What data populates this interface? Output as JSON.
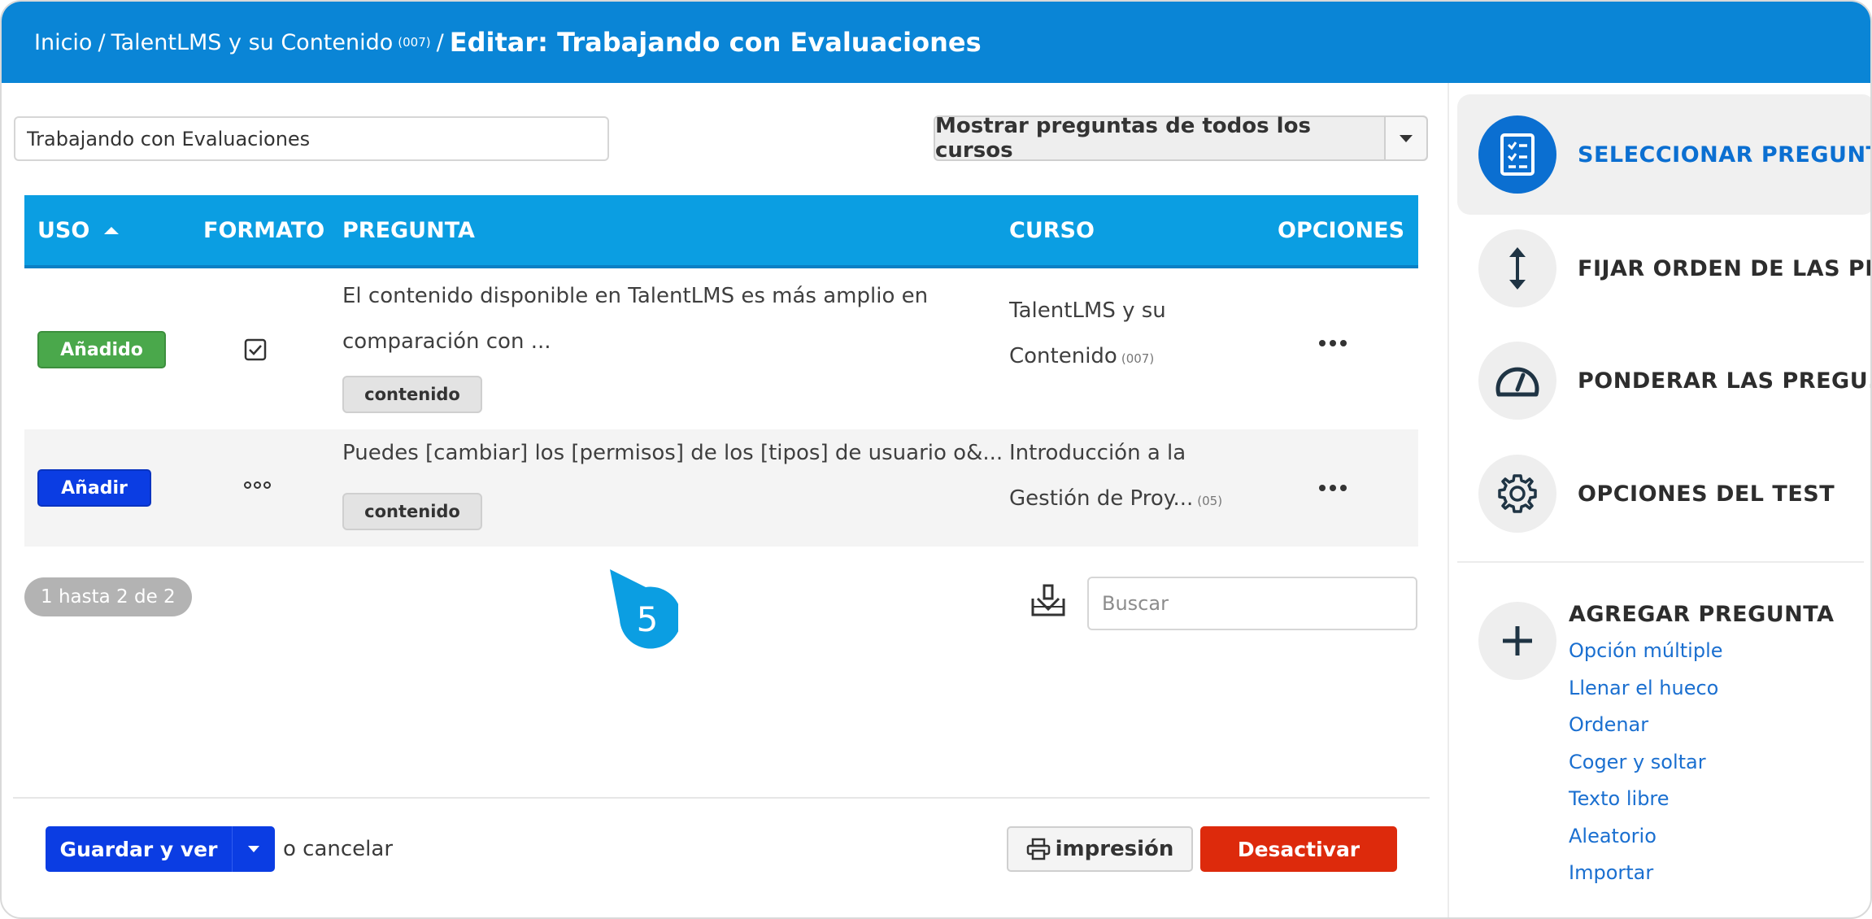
{
  "breadcrumb": {
    "home": "Inicio",
    "course": "TalentLMS y su Contenido",
    "course_code": "(007)",
    "current": "Editar: Trabajando con Evaluaciones"
  },
  "test_title": "Trabajando con Evaluaciones",
  "show_questions": {
    "label": "Mostrar preguntas de todos los cursos"
  },
  "table": {
    "columns": {
      "uso": "USO",
      "formato": "FORMATO",
      "pregunta": "PREGUNTA",
      "curso": "CURSO",
      "opciones": "OPCIONES"
    },
    "rows": [
      {
        "status": "Añadido",
        "format_icon": "checkbox-icon",
        "question_line1": "El contenido disponible en TalentLMS es más amplio en",
        "question_line2": "comparación con ...",
        "tag": "contenido",
        "course_line1": "TalentLMS y su",
        "course_line2": "Contenido",
        "course_code": "(007)"
      },
      {
        "status": "Añadir",
        "format_icon": "ordering-icon",
        "question_line1": "Puedes [cambiar] los [permisos] de los [tipos] de usuario o&...",
        "tag": "contenido",
        "course_line1": "Introducción a la",
        "course_line2": "Gestión de Proy...",
        "course_code": "(05)"
      }
    ]
  },
  "pager": "1 hasta 2 de 2",
  "callout_step": "5",
  "search": {
    "placeholder": "Buscar"
  },
  "footer": {
    "save_label": "Guardar y ver",
    "cancel_text": "o cancelar",
    "print_label": "impresión",
    "deactivate_label": "Desactivar"
  },
  "sidebar": {
    "items": [
      {
        "label": "SELECCIONAR PREGUNT...",
        "icon": "question-list-icon",
        "active": true
      },
      {
        "label": "FIJAR ORDEN DE LAS PR...",
        "icon": "vertical-arrows-icon"
      },
      {
        "label": "PONDERAR LAS PREGU...",
        "icon": "gauge-icon"
      },
      {
        "label": "OPCIONES DEL TEST",
        "icon": "gear-icon"
      }
    ],
    "add_question": {
      "title": "AGREGAR PREGUNTA",
      "types": [
        "Opción múltiple",
        "Llenar el hueco",
        "Ordenar",
        "Coger y soltar",
        "Texto libre",
        "Aleatorio",
        "Importar"
      ]
    }
  },
  "colors": {
    "header": "#0a85d6",
    "table_header": "#0b9ee2",
    "added": "#4aa84b",
    "add": "#0b3de3",
    "deactivate": "#dd2a0c",
    "link": "#1a6fd0"
  }
}
